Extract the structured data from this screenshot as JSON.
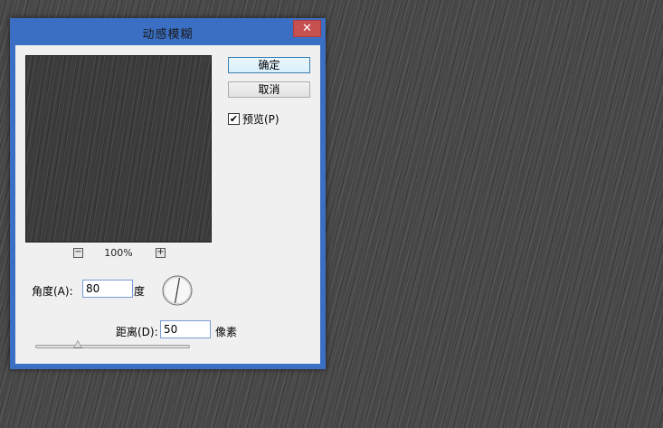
{
  "dialog": {
    "title": "动感模糊",
    "close_icon": "close-icon",
    "buttons": {
      "ok_label": "确定",
      "cancel_label": "取消"
    },
    "preview": {
      "checkbox_label": "预览(P)",
      "checked": true
    },
    "zoom": {
      "level": "100%",
      "zoom_out_icon": "minus-icon",
      "zoom_in_icon": "plus-icon"
    },
    "angle": {
      "label": "角度(A):",
      "value": "80",
      "unit": "度"
    },
    "distance": {
      "label": "距离(D):",
      "value": "50",
      "unit": "像素",
      "slider_fraction": 0.27
    }
  },
  "colors": {
    "titlebar": "#3b6fc4",
    "close_button": "#c75050",
    "canvas": "#474747"
  }
}
